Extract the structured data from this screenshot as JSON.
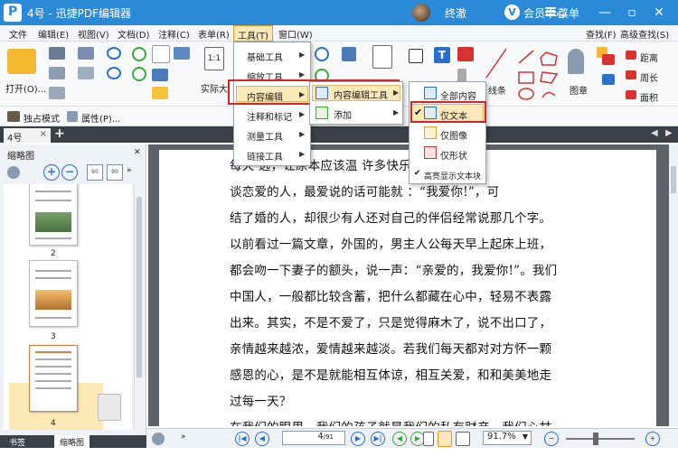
{
  "app": {
    "title": "4号 - 迅捷PDF编辑器",
    "user": "终澈",
    "vip": "V",
    "member_center": "会员中心",
    "menu": "菜单"
  },
  "menubar": {
    "items": [
      "文件",
      "编辑(E)",
      "视图(V)",
      "文档(D)",
      "注释(C)",
      "表单(R)",
      "工具(T)",
      "窗口(W)"
    ],
    "active_index": 6
  },
  "ribbon": {
    "open": "打开(O)...",
    "actual_size": "实际大",
    "find": "查找(F)",
    "advanced_find": "高级查找(S)",
    "line": "线条",
    "stamp": "图章",
    "distance": "距离",
    "perimeter": "周长",
    "area": "面积",
    "exclusive_mode": "独占模式",
    "properties": "属性(P)..."
  },
  "tools_menu": {
    "items": [
      "基础工具",
      "缩放工具",
      "内容编辑",
      "注释和标记",
      "测量工具",
      "链接工具"
    ],
    "highlighted_index": 2
  },
  "content_edit_menu": {
    "items": [
      "内容编辑工具",
      "添加"
    ],
    "highlighted_index": 0
  },
  "content_tool_menu": {
    "items": [
      "全部内容",
      "仅文本",
      "仅图像",
      "仅形状",
      "高亮显示文本块"
    ],
    "checked": [
      false,
      true,
      false,
      false,
      true
    ]
  },
  "tab": {
    "name": "4号",
    "close": "×",
    "add": "+"
  },
  "left_panel": {
    "title": "缩略图",
    "pages": [
      "2",
      "3",
      "4"
    ],
    "tabs": [
      "书签",
      "缩略图"
    ],
    "selected_tab": 1,
    "selected_page": "4"
  },
  "document": {
    "lines": [
      "每天     远，让原本应该温                         许多快乐和幸福。",
      "谈恋爱的人，最爱说的话可能就                    ：“我爱你!”，可",
      "结了婚的人，却很少有人还对自己的伴侣经常说那几个字。",
      "以前看过一篇文章，外国的，男主人公每天早上起床上班，",
      "都会吻一下妻子的额头，说一声：“亲爱的，我爱你!”。我们",
      "中国人，一般都比较含蓄，把什么都藏在心中，轻易不表露",
      "出来。其实，不是不爱了，只是觉得麻木了，说不出口了，",
      "亲情越来越浓，爱情越来越淡。若我们每天都对对方怀一颗",
      "感恩的心，是不是就能相互体谅，相互关爱，和和美美地走",
      "过每一天？",
      "在我们的眼里，我们的孩子就是我们的私有财产，我们心甘"
    ]
  },
  "statusbar": {
    "current_page": "4",
    "total_pages": "91",
    "zoom": "91.7%"
  },
  "colors": {
    "titlebar": "#2a8ad8",
    "highlight_border": "#e02020",
    "menu_highlight": "#fce8b8"
  }
}
